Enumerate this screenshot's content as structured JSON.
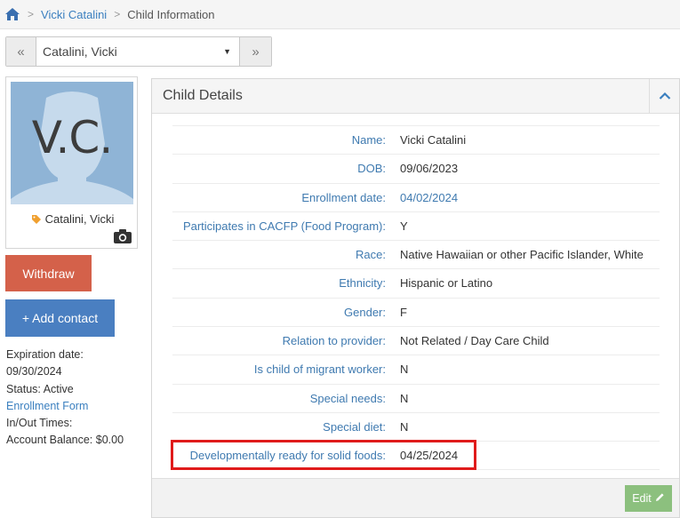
{
  "breadcrumb": {
    "items": [
      {
        "label": "Vicki Catalini"
      },
      {
        "label": "Child Information"
      }
    ]
  },
  "selector": {
    "prev": "«",
    "value": "Catalini, Vicki",
    "caret": "▼",
    "next": "»"
  },
  "photo": {
    "initials": "V.C.",
    "name": "Catalini, Vicki"
  },
  "actions": {
    "withdraw": "Withdraw",
    "add_contact": "+ Add contact"
  },
  "info": {
    "expiration_label": "Expiration date:",
    "expiration_value": "09/30/2024",
    "status": "Status: Active",
    "enrollment_form": "Enrollment Form",
    "inout": "In/Out Times:",
    "balance": "Account Balance: $0.00"
  },
  "panel": {
    "title": "Child Details",
    "edit": "Edit"
  },
  "details": [
    {
      "label": "Name:",
      "value": "Vicki Catalini"
    },
    {
      "label": "DOB:",
      "value": "09/06/2023"
    },
    {
      "label": "Enrollment date:",
      "value": "04/02/2024"
    },
    {
      "label": "Participates in CACFP (Food Program):",
      "value": "Y"
    },
    {
      "label": "Race:",
      "value": "Native Hawaiian or other Pacific Islander, White"
    },
    {
      "label": "Ethnicity:",
      "value": "Hispanic or Latino"
    },
    {
      "label": "Gender:",
      "value": "F"
    },
    {
      "label": "Relation to provider:",
      "value": "Not Related / Day Care Child"
    },
    {
      "label": "Is child of migrant worker:",
      "value": "N"
    },
    {
      "label": "Special needs:",
      "value": "N"
    },
    {
      "label": "Special diet:",
      "value": "N"
    },
    {
      "label": "Developmentally ready for solid foods:",
      "value": "04/25/2024"
    }
  ],
  "colors": {
    "link": "#3f7ab0",
    "withdraw": "#d4614a",
    "add_contact": "#4a7fc1",
    "edit": "#8cc07e",
    "highlight": "#e01b1b"
  },
  "icons": [
    "home-icon",
    "tag-icon",
    "camera-icon",
    "chevron-up-icon",
    "pencil-icon"
  ]
}
